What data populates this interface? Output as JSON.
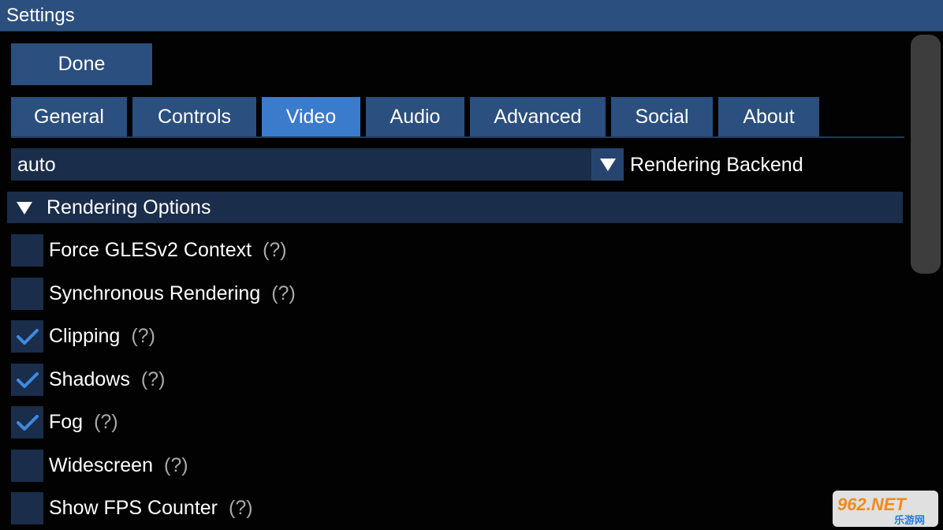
{
  "window": {
    "title": "Settings"
  },
  "done_label": "Done",
  "tabs": [
    {
      "label": "General",
      "active": false
    },
    {
      "label": "Controls",
      "active": false
    },
    {
      "label": "Video",
      "active": true
    },
    {
      "label": "Audio",
      "active": false
    },
    {
      "label": "Advanced",
      "active": false
    },
    {
      "label": "Social",
      "active": false
    },
    {
      "label": "About",
      "active": false
    }
  ],
  "rendering_backend": {
    "value": "auto",
    "label": "Rendering Backend",
    "arrow_icon": "triangle-down-icon"
  },
  "section": {
    "label": "Rendering Options",
    "expanded_icon": "triangle-down-icon"
  },
  "options": [
    {
      "label": "Force GLESv2 Context",
      "help": "(?)",
      "checked": false
    },
    {
      "label": "Synchronous Rendering",
      "help": "(?)",
      "checked": false
    },
    {
      "label": "Clipping",
      "help": "(?)",
      "checked": true
    },
    {
      "label": "Shadows",
      "help": "(?)",
      "checked": true
    },
    {
      "label": "Fog",
      "help": "(?)",
      "checked": true
    },
    {
      "label": "Widescreen",
      "help": "(?)",
      "checked": false
    },
    {
      "label": "Show FPS Counter",
      "help": "(?)",
      "checked": false
    }
  ],
  "watermark": {
    "top": "962.NET",
    "bottom": "乐游网"
  },
  "colors": {
    "bar": "#2b4f7e",
    "active_tab": "#3b7bcc",
    "field": "#1a2d4a",
    "check": "#3d8be0"
  }
}
